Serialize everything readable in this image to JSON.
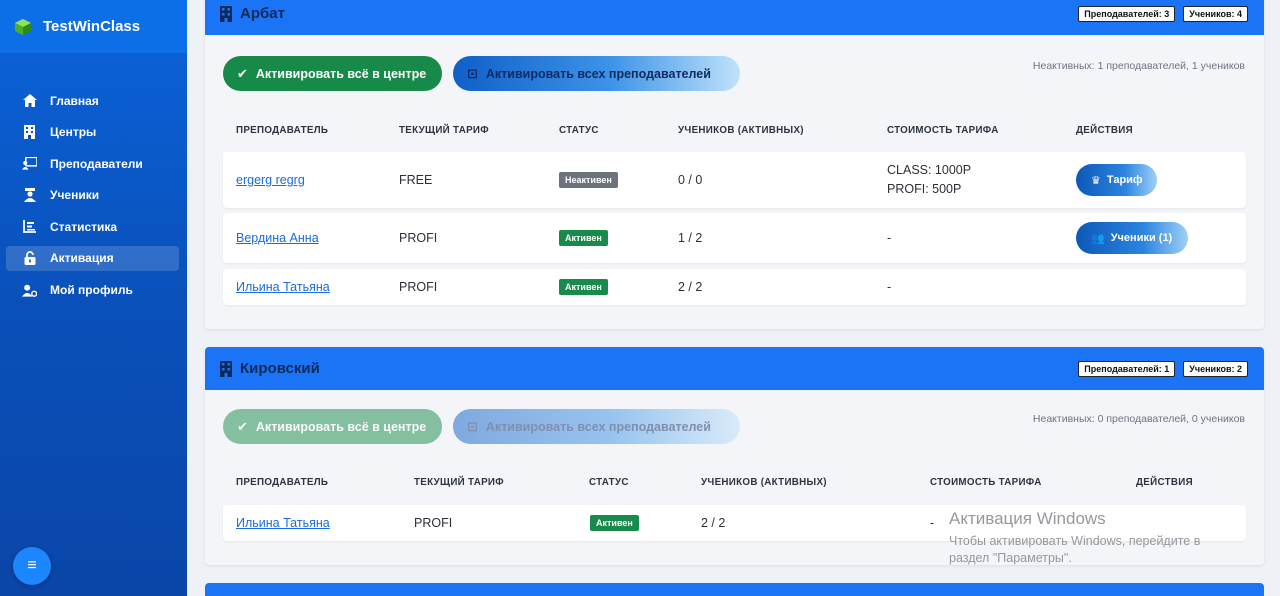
{
  "app": {
    "title": "TestWinClass"
  },
  "sidebar": {
    "items": [
      {
        "label": "Главная",
        "icon": "home-icon"
      },
      {
        "label": "Центры",
        "icon": "building-icon"
      },
      {
        "label": "Преподаватели",
        "icon": "teacher-icon"
      },
      {
        "label": "Ученики",
        "icon": "student-icon"
      },
      {
        "label": "Статистика",
        "icon": "chart-icon"
      },
      {
        "label": "Активация",
        "icon": "unlock-icon",
        "active": true
      },
      {
        "label": "Мой профиль",
        "icon": "user-cog-icon"
      }
    ],
    "fab_icon": "menu-icon"
  },
  "centers": [
    {
      "name": "Арбат",
      "teachers_badge": "Преподавателей: 3",
      "students_badge": "Учеников: 4",
      "activate_all_label": "Активировать всё в центре",
      "activate_teachers_label": "Активировать всех преподавателей",
      "inactive_note": "Неактивных: 1 преподавателей, 1 учеников",
      "columns": [
        "ПРЕПОДАВАТЕЛЬ",
        "ТЕКУЩИЙ ТАРИФ",
        "СТАТУС",
        "УЧЕНИКОВ (АКТИВНЫХ)",
        "СТОИМОСТЬ ТАРИФА",
        "ДЕЙСТВИЯ"
      ],
      "rows": [
        {
          "teacher": "ergerg regrg",
          "tariff": "FREE",
          "status": "Неактивен",
          "students": "0 / 0",
          "price": [
            "CLASS: 1000Р",
            "PROFI: 500Р"
          ],
          "action": "Тариф"
        },
        {
          "teacher": "Вердина Анна",
          "tariff": "PROFI",
          "status": "Активен",
          "students": "1 / 2",
          "price": [
            "-"
          ],
          "action": "Ученики (1)"
        },
        {
          "teacher": "Ильина Татьяна",
          "tariff": "PROFI",
          "status": "Активен",
          "students": "2 / 2",
          "price": [
            "-"
          ],
          "action": ""
        }
      ]
    },
    {
      "name": "Кировский",
      "teachers_badge": "Преподавателей: 1",
      "students_badge": "Учеников: 2",
      "activate_all_label": "Активировать всё в центре",
      "activate_teachers_label": "Активировать всех преподавателей",
      "inactive_note": "Неактивных: 0 преподавателей, 0 учеников",
      "columns": [
        "ПРЕПОДАВАТЕЛЬ",
        "ТЕКУЩИЙ ТАРИФ",
        "СТАТУС",
        "УЧЕНИКОВ (АКТИВНЫХ)",
        "СТОИМОСТЬ ТАРИФА",
        "ДЕЙСТВИЯ"
      ],
      "rows": [
        {
          "teacher": "Ильина Татьяна",
          "tariff": "PROFI",
          "status": "Активен",
          "students": "2 / 2",
          "price": [
            "-"
          ],
          "action": ""
        }
      ]
    }
  ],
  "watermark": {
    "title": "Активация Windows",
    "line1": "Чтобы активировать Windows, перейдите в",
    "line2": "раздел \"Параметры\"."
  }
}
